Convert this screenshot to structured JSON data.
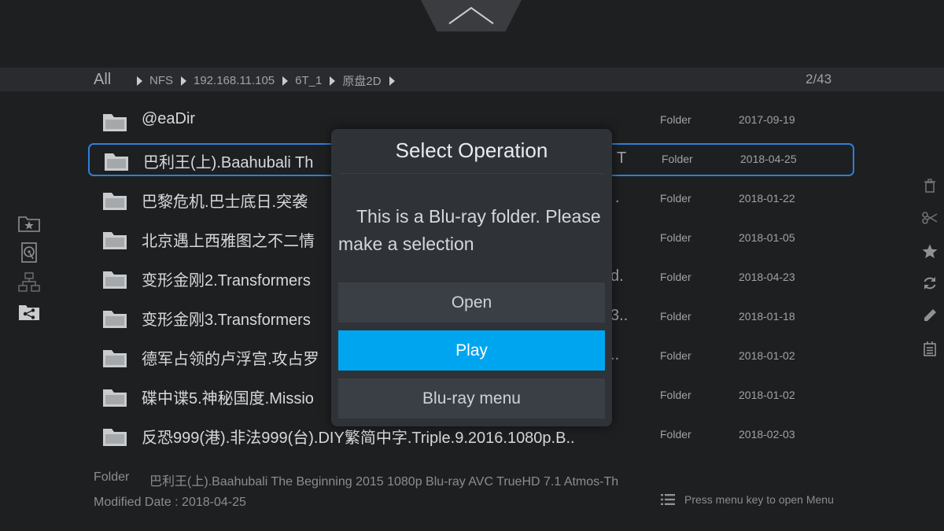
{
  "breadcrumb": {
    "root": "All",
    "segments": [
      "NFS",
      "192.168.11.105",
      "6T_1",
      "原盘2D"
    ],
    "page_count": "2/43"
  },
  "files": [
    {
      "name": "@eaDir",
      "type": "Folder",
      "date": "2017-09-19"
    },
    {
      "name": "巴利王(上).Baahubali Th",
      "suffix": "T",
      "type": "Folder",
      "date": "2018-04-25"
    },
    {
      "name": "巴黎危机.巴士底日.突袭",
      "suffix": ".",
      "type": "Folder",
      "date": "2018-01-22"
    },
    {
      "name": "北京遇上西雅图之不二情",
      "suffix": "",
      "type": "Folder",
      "date": "2018-01-05"
    },
    {
      "name": "变形金刚2.Transformers",
      "suffix": "d.",
      "type": "Folder",
      "date": "2018-04-23"
    },
    {
      "name": "变形金刚3.Transformers",
      "suffix": "3..",
      "type": "Folder",
      "date": "2018-01-18"
    },
    {
      "name": "德军占领的卢浮宫.攻占罗",
      "suffix": "..",
      "type": "Folder",
      "date": "2018-01-02"
    },
    {
      "name": "碟中谍5.神秘国度.Missio",
      "suffix": "",
      "type": "Folder",
      "date": "2018-01-02"
    },
    {
      "name": "反恐999(港).非法999(台).DIY繁简中字.Triple.9.2016.1080p.B..",
      "suffix": "",
      "type": "Folder",
      "date": "2018-02-03"
    }
  ],
  "info": {
    "type_label": "Folder",
    "name": "巴利王(上).Baahubali The Beginning 2015 1080p Blu-ray AVC TrueHD 7.1 Atmos-Th",
    "modified": "Modified Date : 2018-04-25"
  },
  "hint": "Press menu key to open Menu",
  "dialog": {
    "title": "Select Operation",
    "message": "This is a Blu-ray folder. Please make a selection",
    "buttons": [
      "Open",
      "Play",
      "Blu-ray menu"
    ],
    "active_button": "Play"
  },
  "colors": {
    "accent": "#00a5ef",
    "selection_border": "#2f7fd8",
    "background": "#1e1f21"
  },
  "icons": {
    "left_nav": [
      "favorites-folder-icon",
      "local-disk-icon",
      "network-icon",
      "shared-folder-icon"
    ],
    "right_tools": [
      "trash-icon",
      "scissors-icon",
      "star-icon",
      "refresh-icon",
      "pencil-icon",
      "info-list-icon"
    ]
  }
}
